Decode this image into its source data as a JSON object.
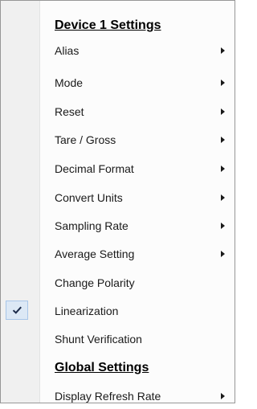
{
  "menu": {
    "device_header": "Device 1 Settings",
    "items": [
      {
        "label": "Alias"
      },
      {
        "label": "Mode"
      },
      {
        "label": "Reset"
      },
      {
        "label": "Tare / Gross"
      },
      {
        "label": "Decimal Format"
      },
      {
        "label": "Convert Units"
      },
      {
        "label": "Sampling Rate"
      },
      {
        "label": "Average Setting"
      },
      {
        "label": "Change Polarity"
      },
      {
        "label": "Linearization",
        "checked": true
      },
      {
        "label": "Shunt Verification"
      }
    ],
    "global_header": "Global Settings",
    "global_items": [
      {
        "label": "Display Refresh Rate"
      }
    ]
  },
  "icons": {
    "submenu": "chevron-right-icon",
    "checked": "checkmark-icon"
  },
  "colors": {
    "gutter": "#f0f0f0",
    "check_highlight": "#dce8f5"
  }
}
